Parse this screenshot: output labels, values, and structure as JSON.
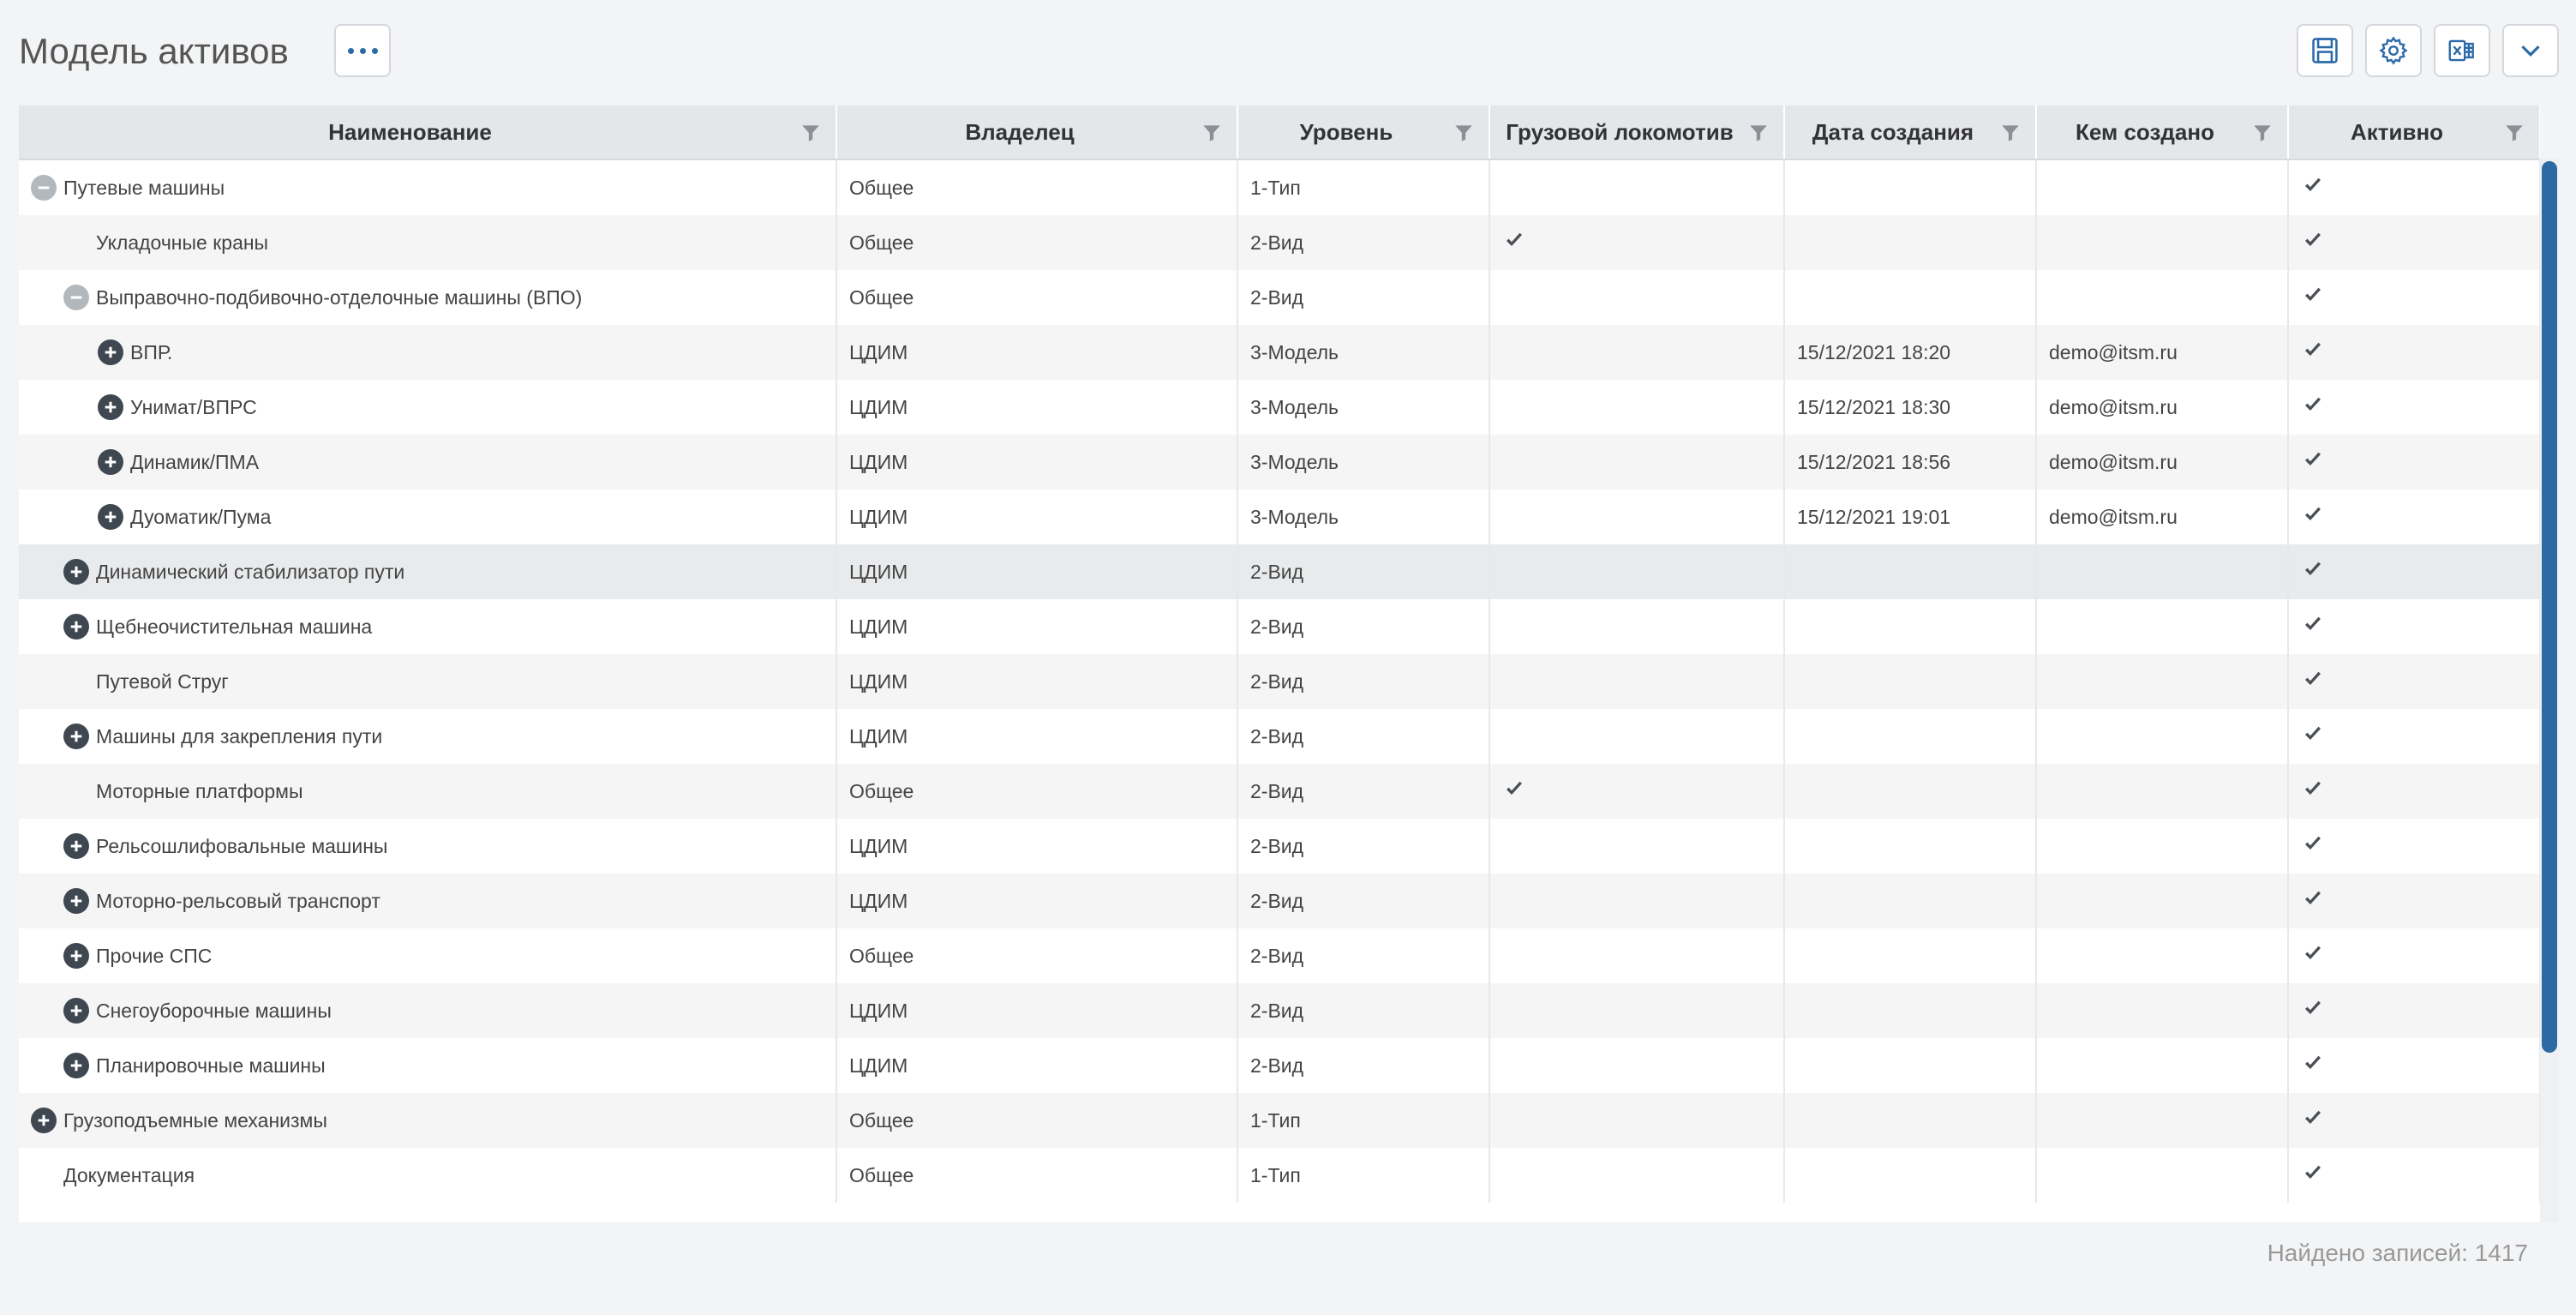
{
  "header": {
    "title": "Модель активов",
    "more_icon": "dots-horizontal-icon",
    "tools": [
      "save-icon",
      "gear-icon",
      "excel-export-icon",
      "chevron-down-icon"
    ]
  },
  "colors": {
    "accent": "#2b6aa8",
    "header_bg": "#e4e7ea",
    "scroll_thumb": "#2d6aa3"
  },
  "grid": {
    "columns": [
      "Наименование",
      "Владелец",
      "Уровень",
      "Грузовой локомотив",
      "Дата создания",
      "Кем создано",
      "Активно"
    ],
    "rows": [
      {
        "level": 0,
        "toggle": "minus",
        "name": "Путевые машины",
        "owner": "Общее",
        "lvl": "1-Тип",
        "loco": false,
        "date": "",
        "author": "",
        "active": true
      },
      {
        "level": 1,
        "toggle": "none",
        "name": "Укладочные краны",
        "owner": "Общее",
        "lvl": "2-Вид",
        "loco": true,
        "date": "",
        "author": "",
        "active": true
      },
      {
        "level": 1,
        "toggle": "minus",
        "name": "Выправочно-подбивочно-отделочные машины (ВПО)",
        "owner": "Общее",
        "lvl": "2-Вид",
        "loco": false,
        "date": "",
        "author": "",
        "active": true
      },
      {
        "level": 2,
        "toggle": "plus",
        "name": "ВПР.",
        "owner": "ЦДИМ",
        "lvl": "3-Модель",
        "loco": false,
        "date": "15/12/2021 18:20",
        "author": "demo@itsm.ru",
        "active": true
      },
      {
        "level": 2,
        "toggle": "plus",
        "name": "Унимат/ВПРС",
        "owner": "ЦДИМ",
        "lvl": "3-Модель",
        "loco": false,
        "date": "15/12/2021 18:30",
        "author": "demo@itsm.ru",
        "active": true
      },
      {
        "level": 2,
        "toggle": "plus",
        "name": "Динамик/ПМА",
        "owner": "ЦДИМ",
        "lvl": "3-Модель",
        "loco": false,
        "date": "15/12/2021 18:56",
        "author": "demo@itsm.ru",
        "active": true
      },
      {
        "level": 2,
        "toggle": "plus",
        "name": "Дуоматик/Пума",
        "owner": "ЦДИМ",
        "lvl": "3-Модель",
        "loco": false,
        "date": "15/12/2021 19:01",
        "author": "demo@itsm.ru",
        "active": true
      },
      {
        "level": 1,
        "toggle": "plus",
        "name": "Динамический стабилизатор пути",
        "owner": "ЦДИМ",
        "lvl": "2-Вид",
        "loco": false,
        "date": "",
        "author": "",
        "active": true,
        "highlight": true
      },
      {
        "level": 1,
        "toggle": "plus",
        "name": "Щебнеочистительная машина",
        "owner": "ЦДИМ",
        "lvl": "2-Вид",
        "loco": false,
        "date": "",
        "author": "",
        "active": true
      },
      {
        "level": 1,
        "toggle": "none",
        "name": "Путевой Струг",
        "owner": "ЦДИМ",
        "lvl": "2-Вид",
        "loco": false,
        "date": "",
        "author": "",
        "active": true
      },
      {
        "level": 1,
        "toggle": "plus",
        "name": "Машины для закрепления пути",
        "owner": "ЦДИМ",
        "lvl": "2-Вид",
        "loco": false,
        "date": "",
        "author": "",
        "active": true
      },
      {
        "level": 1,
        "toggle": "none",
        "name": "Моторные платформы",
        "owner": "Общее",
        "lvl": "2-Вид",
        "loco": true,
        "date": "",
        "author": "",
        "active": true
      },
      {
        "level": 1,
        "toggle": "plus",
        "name": "Рельсошлифовальные машины",
        "owner": "ЦДИМ",
        "lvl": "2-Вид",
        "loco": false,
        "date": "",
        "author": "",
        "active": true
      },
      {
        "level": 1,
        "toggle": "plus",
        "name": "Моторно-рельсовый транспорт",
        "owner": "ЦДИМ",
        "lvl": "2-Вид",
        "loco": false,
        "date": "",
        "author": "",
        "active": true
      },
      {
        "level": 1,
        "toggle": "plus",
        "name": "Прочие СПС",
        "owner": "Общее",
        "lvl": "2-Вид",
        "loco": false,
        "date": "",
        "author": "",
        "active": true
      },
      {
        "level": 1,
        "toggle": "plus",
        "name": "Снегоуборочные машины",
        "owner": "ЦДИМ",
        "lvl": "2-Вид",
        "loco": false,
        "date": "",
        "author": "",
        "active": true
      },
      {
        "level": 1,
        "toggle": "plus",
        "name": "Планировочные машины",
        "owner": "ЦДИМ",
        "lvl": "2-Вид",
        "loco": false,
        "date": "",
        "author": "",
        "active": true
      },
      {
        "level": 0,
        "toggle": "plus",
        "name": "Грузоподъемные механизмы",
        "owner": "Общее",
        "lvl": "1-Тип",
        "loco": false,
        "date": "",
        "author": "",
        "active": true
      },
      {
        "level": 0,
        "toggle": "none",
        "name": "Документация",
        "owner": "Общее",
        "lvl": "1-Тип",
        "loco": false,
        "date": "",
        "author": "",
        "active": true
      }
    ]
  },
  "footer": {
    "records_found": "Найдено записей: 1417"
  }
}
